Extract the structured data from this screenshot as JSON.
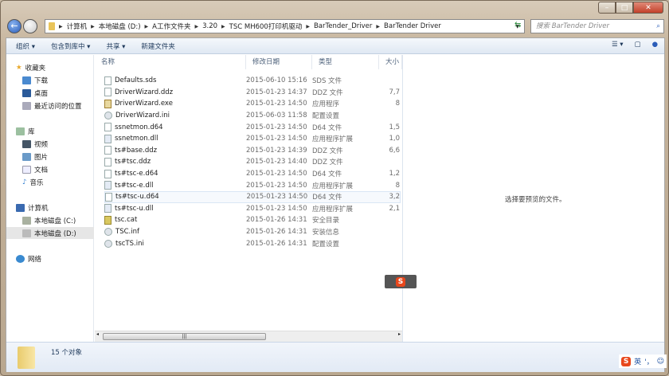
{
  "window": {
    "minimize": "–",
    "maximize": "□",
    "close": "✕"
  },
  "address": {
    "crumbs": [
      "计算机",
      "本地磁盘 (D:)",
      "A工作文件夹",
      "3.20",
      "TSC MH600打印机驱动",
      "BarTender_Driver",
      "BarTender Driver"
    ],
    "search_placeholder": "搜索 BarTender Driver"
  },
  "toolbar": {
    "organize": "组织 ▾",
    "include": "包含到库中 ▾",
    "share": "共享 ▾",
    "new_folder": "新建文件夹"
  },
  "nav": {
    "favorites": "收藏夹",
    "downloads": "下载",
    "desktop": "桌面",
    "recent": "最近访问的位置",
    "libraries": "库",
    "videos": "视频",
    "pictures": "图片",
    "documents": "文档",
    "music": "音乐",
    "computer": "计算机",
    "drive_c": "本地磁盘 (C:)",
    "drive_d": "本地磁盘 (D:)",
    "network": "网络"
  },
  "columns": {
    "name": "名称",
    "date": "修改日期",
    "type": "类型",
    "size": "大小"
  },
  "files": [
    {
      "name": "Defaults.sds",
      "date": "2015-06-10 15:16",
      "type": "SDS 文件",
      "size": "",
      "icon": "file"
    },
    {
      "name": "DriverWizard.ddz",
      "date": "2015-01-23 14:37",
      "type": "DDZ 文件",
      "size": "7,7",
      "icon": "file"
    },
    {
      "name": "DriverWizard.exe",
      "date": "2015-01-23 14:50",
      "type": "应用程序",
      "size": "8",
      "icon": "exe"
    },
    {
      "name": "DriverWizard.ini",
      "date": "2015-06-03 11:58",
      "type": "配置设置",
      "size": "",
      "icon": "ini"
    },
    {
      "name": "ssnetmon.d64",
      "date": "2015-01-23 14:50",
      "type": "D64 文件",
      "size": "1,5",
      "icon": "file"
    },
    {
      "name": "ssnetmon.dll",
      "date": "2015-01-23 14:50",
      "type": "应用程序扩展",
      "size": "1,0",
      "icon": "dll"
    },
    {
      "name": "ts#base.ddz",
      "date": "2015-01-23 14:39",
      "type": "DDZ 文件",
      "size": "6,6",
      "icon": "file"
    },
    {
      "name": "ts#tsc.ddz",
      "date": "2015-01-23 14:40",
      "type": "DDZ 文件",
      "size": "",
      "icon": "file"
    },
    {
      "name": "ts#tsc-e.d64",
      "date": "2015-01-23 14:50",
      "type": "D64 文件",
      "size": "1,2",
      "icon": "file"
    },
    {
      "name": "ts#tsc-e.dll",
      "date": "2015-01-23 14:50",
      "type": "应用程序扩展",
      "size": "8",
      "icon": "dll"
    },
    {
      "name": "ts#tsc-u.d64",
      "date": "2015-01-23 14:50",
      "type": "D64 文件",
      "size": "3,2",
      "icon": "file"
    },
    {
      "name": "ts#tsc-u.dll",
      "date": "2015-01-23 14:50",
      "type": "应用程序扩展",
      "size": "2,1",
      "icon": "dll"
    },
    {
      "name": "tsc.cat",
      "date": "2015-01-26 14:31",
      "type": "安全目录",
      "size": "",
      "icon": "cat"
    },
    {
      "name": "TSC.inf",
      "date": "2015-01-26 14:31",
      "type": "安装信息",
      "size": "",
      "icon": "inf"
    },
    {
      "name": "tscTS.ini",
      "date": "2015-01-26 14:31",
      "type": "配置设置",
      "size": "",
      "icon": "ini"
    }
  ],
  "preview": {
    "message": "选择要预览的文件。"
  },
  "status": {
    "count": "15 个对象"
  },
  "ime": {
    "logo": "S",
    "lang": "英",
    "punct": "'，"
  }
}
